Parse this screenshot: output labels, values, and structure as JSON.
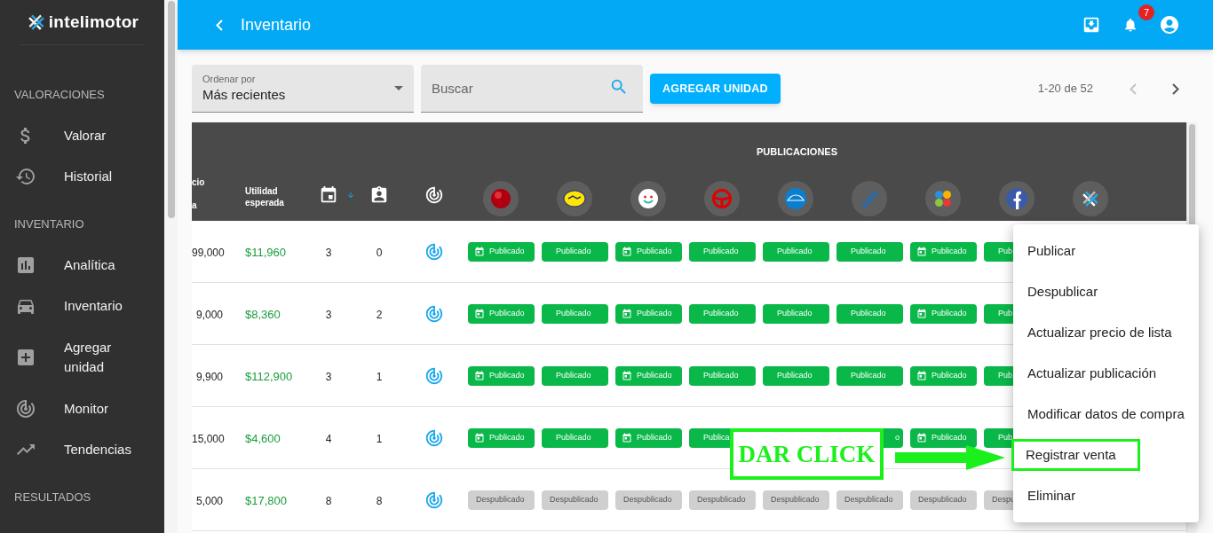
{
  "sidebar": {
    "brand": "intelimotor",
    "sections": [
      {
        "title": "VALORACIONES",
        "items": [
          {
            "label": "Valorar"
          },
          {
            "label": "Historial"
          }
        ]
      },
      {
        "title": "INVENTARIO",
        "items": [
          {
            "label": "Analítica"
          },
          {
            "label": "Inventario"
          },
          {
            "label": "Agregar unidad"
          },
          {
            "label": "Monitor"
          },
          {
            "label": "Tendencias"
          }
        ]
      },
      {
        "title": "RESULTADOS"
      }
    ]
  },
  "header": {
    "title": "Inventario",
    "notifications": "7"
  },
  "toolbar": {
    "sort": {
      "label": "Ordenar por",
      "value": "Más recientes"
    },
    "search": {
      "placeholder": "Buscar"
    },
    "add_button": "AGREGAR UNIDAD",
    "pagination": {
      "range": "1-20 de 52",
      "prev_disabled": true
    }
  },
  "table": {
    "columns": {
      "price": [
        "cio",
        "a"
      ],
      "profit": "Utilidad esperada",
      "publications": "PUBLICACIONES"
    },
    "rows": [
      {
        "price": "99,000",
        "profit": "$11,960",
        "days": "3",
        "leads": "0",
        "chips": [
          {
            "label": "Publicado",
            "kind": "published",
            "scheduled": true
          },
          {
            "label": "Publicado",
            "kind": "published",
            "scheduled": false
          },
          {
            "label": "Publicado",
            "kind": "published",
            "scheduled": true
          },
          {
            "label": "Publicado",
            "kind": "published",
            "scheduled": false
          },
          {
            "label": "Publicado",
            "kind": "published",
            "scheduled": false
          },
          {
            "label": "Publicado",
            "kind": "published",
            "scheduled": false
          },
          {
            "label": "Publicado",
            "kind": "published",
            "scheduled": true
          },
          {
            "label": "Pub",
            "kind": "published",
            "scheduled": false
          }
        ]
      },
      {
        "price": "9,000",
        "profit": "$8,360",
        "days": "3",
        "leads": "2",
        "chips": [
          {
            "label": "Publicado",
            "kind": "published",
            "scheduled": true
          },
          {
            "label": "Publicado",
            "kind": "published",
            "scheduled": false
          },
          {
            "label": "Publicado",
            "kind": "published",
            "scheduled": true
          },
          {
            "label": "Publicado",
            "kind": "published",
            "scheduled": false
          },
          {
            "label": "Publicado",
            "kind": "published",
            "scheduled": false
          },
          {
            "label": "Publicado",
            "kind": "published",
            "scheduled": false
          },
          {
            "label": "Publicado",
            "kind": "published",
            "scheduled": true
          },
          {
            "label": "Pub",
            "kind": "published",
            "scheduled": false
          }
        ]
      },
      {
        "price": "9,900",
        "profit": "$112,900",
        "days": "3",
        "leads": "1",
        "chips": [
          {
            "label": "Publicado",
            "kind": "published",
            "scheduled": true
          },
          {
            "label": "Publicado",
            "kind": "published",
            "scheduled": false
          },
          {
            "label": "Publicado",
            "kind": "published",
            "scheduled": true
          },
          {
            "label": "Publicado",
            "kind": "published",
            "scheduled": false
          },
          {
            "label": "Publicado",
            "kind": "published",
            "scheduled": false
          },
          {
            "label": "Publicado",
            "kind": "published",
            "scheduled": false
          },
          {
            "label": "Publicado",
            "kind": "published",
            "scheduled": true
          },
          {
            "label": "Pub",
            "kind": "published",
            "scheduled": false
          }
        ]
      },
      {
        "price": "15,000",
        "profit": "$4,600",
        "days": "4",
        "leads": "1",
        "chips": [
          {
            "label": "Publicado",
            "kind": "published",
            "scheduled": true
          },
          {
            "label": "Publicado",
            "kind": "published",
            "scheduled": false
          },
          {
            "label": "Publicado",
            "kind": "published",
            "scheduled": true
          },
          {
            "label": "Publica",
            "kind": "published",
            "scheduled": false
          },
          {
            "kind": "covered"
          },
          {
            "label": "o",
            "kind": "fragment"
          },
          {
            "label": "Publicado",
            "kind": "published",
            "scheduled": true
          },
          {
            "label": "Pub",
            "kind": "published",
            "scheduled": false
          }
        ]
      },
      {
        "price": "5,000",
        "profit": "$17,800",
        "days": "8",
        "leads": "8",
        "chips": [
          {
            "label": "Despublicado",
            "kind": "unpublished"
          },
          {
            "label": "Despublicado",
            "kind": "unpublished"
          },
          {
            "label": "Despublicado",
            "kind": "unpublished"
          },
          {
            "label": "Despublicado",
            "kind": "unpublished"
          },
          {
            "label": "Despublicado",
            "kind": "unpublished"
          },
          {
            "label": "Despublicado",
            "kind": "unpublished"
          },
          {
            "label": "Despublicado",
            "kind": "unpublished"
          },
          {
            "label": "Despu",
            "kind": "unpublished"
          }
        ]
      }
    ]
  },
  "menu": {
    "items": [
      {
        "label": "Publicar",
        "highlighted": false
      },
      {
        "label": "Despublicar",
        "highlighted": false
      },
      {
        "label": "Actualizar precio de lista",
        "highlighted": false
      },
      {
        "label": "Actualizar publicación",
        "highlighted": false
      },
      {
        "label": "Modificar datos de compra",
        "highlighted": false
      },
      {
        "label": "Registrar venta",
        "highlighted": true
      },
      {
        "label": "Eliminar",
        "highlighted": false
      }
    ]
  },
  "annotation": {
    "label": "DAR CLICK"
  }
}
